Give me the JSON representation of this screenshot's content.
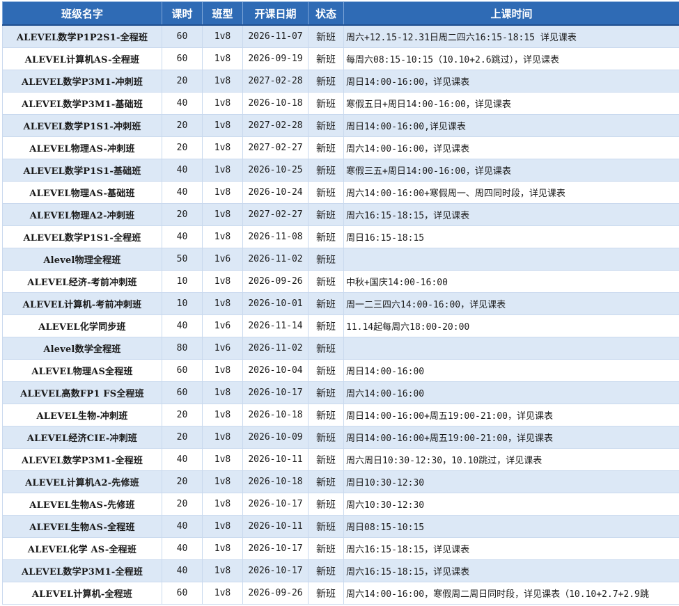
{
  "headers": {
    "name": "班级名字",
    "hours": "课时",
    "type": "班型",
    "start_date": "开课日期",
    "status": "状态",
    "schedule": "上课时间"
  },
  "rows": [
    {
      "name": "ALEVEL数学P1P2S1-全程班",
      "hours": "60",
      "type": "1v8",
      "start_date": "2026-11-07",
      "status": "新班",
      "schedule": "周六+12.15-12.31日周二四六16:15-18:15 详见课表"
    },
    {
      "name": "ALEVEL计算机AS-全程班",
      "hours": "60",
      "type": "1v8",
      "start_date": "2026-09-19",
      "status": "新班",
      "schedule": "每周六08:15-10:15（10.10+2.6跳过），详见课表"
    },
    {
      "name": "ALEVEL数学P3M1-冲刺班",
      "hours": "20",
      "type": "1v8",
      "start_date": "2027-02-28",
      "status": "新班",
      "schedule": "周日14:00-16:00，详见课表"
    },
    {
      "name": "ALEVEL数学P3M1-基础班",
      "hours": "40",
      "type": "1v8",
      "start_date": "2026-10-18",
      "status": "新班",
      "schedule": "寒假五日+周日14:00-16:00，详见课表"
    },
    {
      "name": "ALEVEL数学P1S1-冲刺班",
      "hours": "20",
      "type": "1v8",
      "start_date": "2027-02-28",
      "status": "新班",
      "schedule": "周日14:00-16:00,详见课表"
    },
    {
      "name": "ALEVEL物理AS-冲刺班",
      "hours": "20",
      "type": "1v8",
      "start_date": "2027-02-27",
      "status": "新班",
      "schedule": "周六14:00-16:00，详见课表"
    },
    {
      "name": "ALEVEL数学P1S1-基础班",
      "hours": "40",
      "type": "1v8",
      "start_date": "2026-10-25",
      "status": "新班",
      "schedule": "寒假三五+周日14:00-16:00，详见课表"
    },
    {
      "name": "ALEVEL物理AS-基础班",
      "hours": "40",
      "type": "1v8",
      "start_date": "2026-10-24",
      "status": "新班",
      "schedule": "周六14:00-16:00+寒假周一、周四同时段，详见课表"
    },
    {
      "name": "ALEVEL物理A2-冲刺班",
      "hours": "20",
      "type": "1v8",
      "start_date": "2027-02-27",
      "status": "新班",
      "schedule": "周六16:15-18:15，详见课表"
    },
    {
      "name": "ALEVEL数学P1S1-全程班",
      "hours": "40",
      "type": "1v8",
      "start_date": "2026-11-08",
      "status": "新班",
      "schedule": "周日16:15-18:15"
    },
    {
      "name": "Alevel物理全程班",
      "hours": "50",
      "type": "1v6",
      "start_date": "2026-11-02",
      "status": "新班",
      "schedule": ""
    },
    {
      "name": "ALEVEL经济-考前冲刺班",
      "hours": "10",
      "type": "1v8",
      "start_date": "2026-09-26",
      "status": "新班",
      "schedule": "中秋+国庆14:00-16:00"
    },
    {
      "name": "ALEVEL计算机-考前冲刺班",
      "hours": "10",
      "type": "1v8",
      "start_date": "2026-10-01",
      "status": "新班",
      "schedule": "周一二三四六14:00-16:00，详见课表"
    },
    {
      "name": "ALEVEL化学同步班",
      "hours": "40",
      "type": "1v6",
      "start_date": "2026-11-14",
      "status": "新班",
      "schedule": "11.14起每周六18:00-20:00"
    },
    {
      "name": "Alevel数学全程班",
      "hours": "80",
      "type": "1v6",
      "start_date": "2026-11-02",
      "status": "新班",
      "schedule": ""
    },
    {
      "name": "ALEVEL物理AS全程班",
      "hours": "60",
      "type": "1v8",
      "start_date": "2026-10-04",
      "status": "新班",
      "schedule": "周日14:00-16:00"
    },
    {
      "name": "ALEVEL高数FP1 FS全程班",
      "hours": "60",
      "type": "1v8",
      "start_date": "2026-10-17",
      "status": "新班",
      "schedule": "周六14:00-16:00"
    },
    {
      "name": "ALEVEL生物-冲刺班",
      "hours": "20",
      "type": "1v8",
      "start_date": "2026-10-18",
      "status": "新班",
      "schedule": "周日14:00-16:00+周五19:00-21:00，详见课表"
    },
    {
      "name": "ALEVEL经济CIE-冲刺班",
      "hours": "20",
      "type": "1v8",
      "start_date": "2026-10-09",
      "status": "新班",
      "schedule": "周日14:00-16:00+周五19:00-21:00，详见课表"
    },
    {
      "name": "ALEVEL数学P3M1-全程班",
      "hours": "40",
      "type": "1v8",
      "start_date": "2026-10-11",
      "status": "新班",
      "schedule": "周六周日10:30-12:30，10.10跳过，详见课表"
    },
    {
      "name": "ALEVEL计算机A2-先修班",
      "hours": "20",
      "type": "1v8",
      "start_date": "2026-10-18",
      "status": "新班",
      "schedule": "周日10:30-12:30"
    },
    {
      "name": "ALEVEL生物AS-先修班",
      "hours": "20",
      "type": "1v8",
      "start_date": "2026-10-17",
      "status": "新班",
      "schedule": "周六10:30-12:30"
    },
    {
      "name": "ALEVEL生物AS-全程班",
      "hours": "40",
      "type": "1v8",
      "start_date": "2026-10-11",
      "status": "新班",
      "schedule": "周日08:15-10:15"
    },
    {
      "name": "ALEVEL化学 AS-全程班",
      "hours": "40",
      "type": "1v8",
      "start_date": "2026-10-17",
      "status": "新班",
      "schedule": "周六16:15-18:15，详见课表"
    },
    {
      "name": "ALEVEL数学P3M1-全程班",
      "hours": "40",
      "type": "1v8",
      "start_date": "2026-10-17",
      "status": "新班",
      "schedule": "周六16:15-18:15，详见课表"
    },
    {
      "name": "ALEVEL计算机-全程班",
      "hours": "60",
      "type": "1v8",
      "start_date": "2026-09-26",
      "status": "新班",
      "schedule": "周六14:00-16:00，寒假周二周日同时段，详见课表（10.10+2.7+2.9跳"
    }
  ],
  "colors": {
    "header_bg": "#2f6bb5",
    "stripe": "#dce8f6"
  }
}
